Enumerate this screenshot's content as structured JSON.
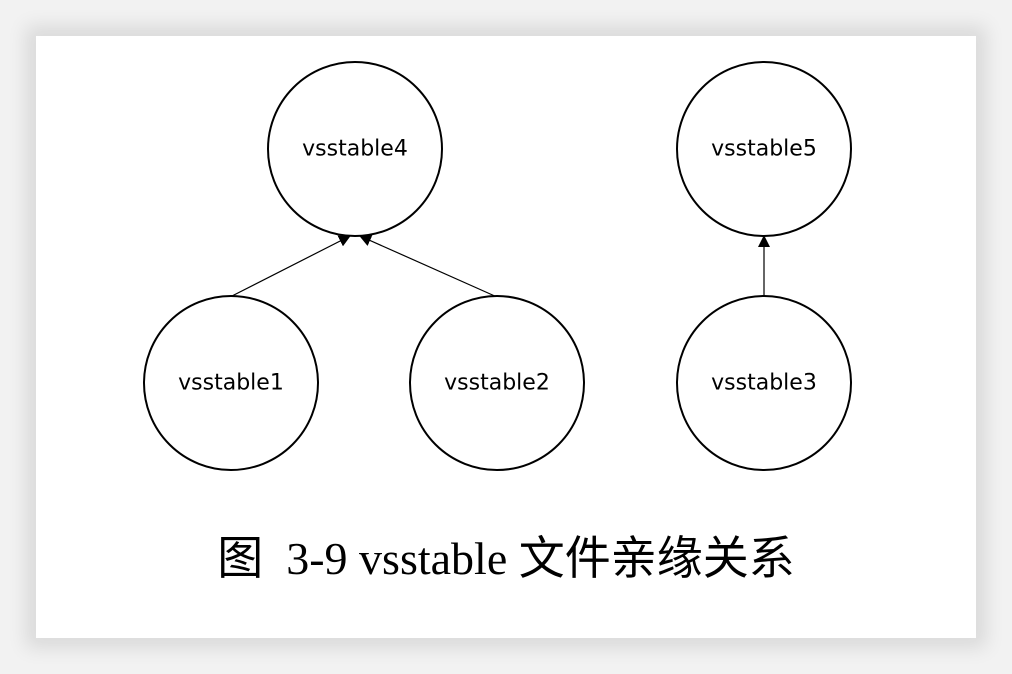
{
  "nodes": {
    "n4": {
      "label": "vsstable4"
    },
    "n5": {
      "label": "vsstable5"
    },
    "n1": {
      "label": "vsstable1"
    },
    "n2": {
      "label": "vsstable2"
    },
    "n3": {
      "label": "vsstable3"
    }
  },
  "edges": [
    {
      "from": "vsstable1",
      "to": "vsstable4"
    },
    {
      "from": "vsstable2",
      "to": "vsstable4"
    },
    {
      "from": "vsstable3",
      "to": "vsstable5"
    }
  ],
  "caption": "图  3-9 vsstable 文件亲缘关系"
}
